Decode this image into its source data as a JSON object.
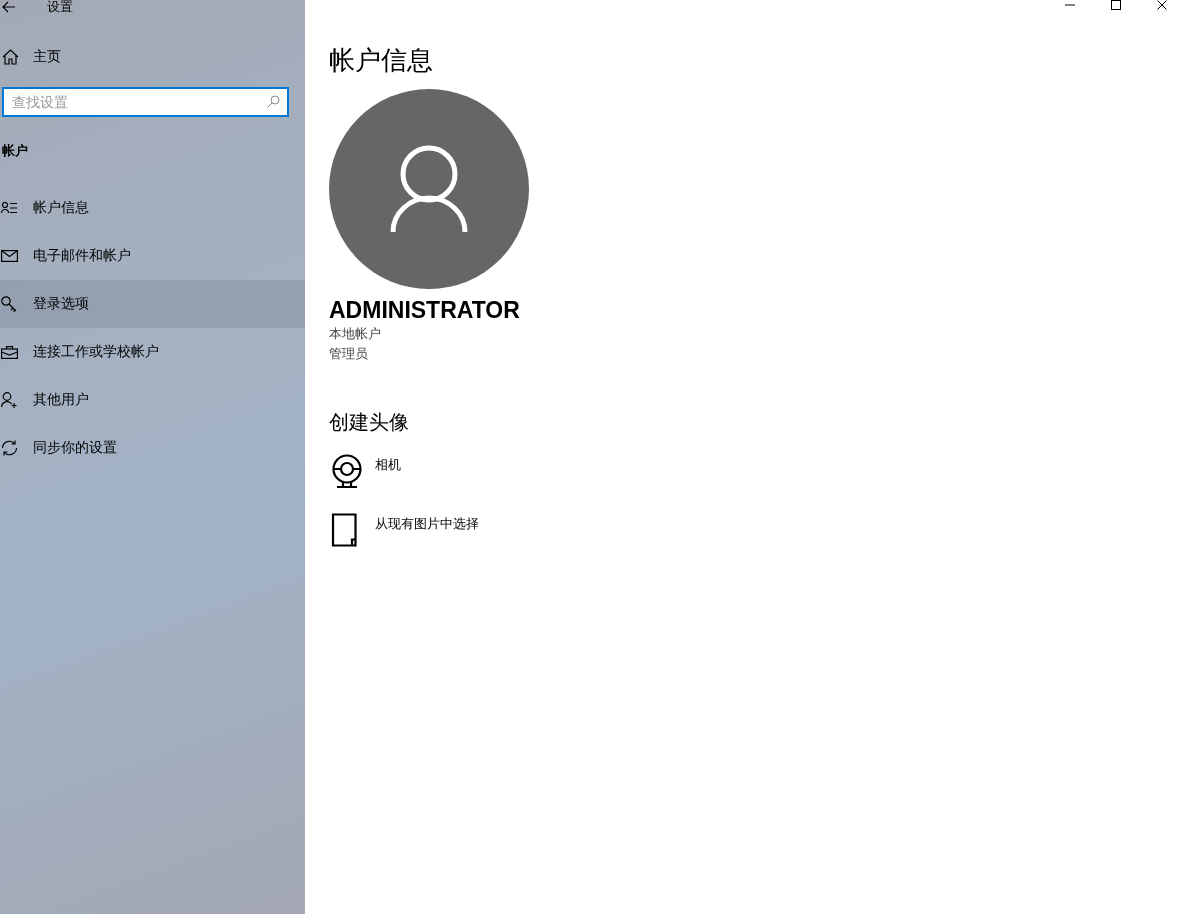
{
  "window": {
    "title": "设置",
    "controls": [
      {
        "kind": "minimize"
      },
      {
        "kind": "maximize"
      },
      {
        "kind": "close"
      }
    ]
  },
  "sidebar": {
    "home": "主页",
    "search": {
      "placeholder": "查找设置"
    },
    "section": "帐户",
    "items": [
      {
        "label": "帐户信息",
        "kind": "info",
        "selected": false
      },
      {
        "label": "电子邮件和帐户",
        "kind": "mail",
        "selected": false
      },
      {
        "label": "登录选项",
        "kind": "signin",
        "selected": true
      },
      {
        "label": "连接工作或学校帐户",
        "kind": "work",
        "selected": false
      },
      {
        "label": "其他用户",
        "kind": "users",
        "selected": false
      },
      {
        "label": "同步你的设置",
        "kind": "sync",
        "selected": false
      }
    ]
  },
  "main": {
    "title": "帐户信息",
    "user": {
      "name": "ADMINISTRATOR",
      "lines": [
        "本地帐户",
        "管理员"
      ]
    },
    "create_heading": "创建头像",
    "options": [
      {
        "label": "相机",
        "kind": "camera"
      },
      {
        "label": "从现有图片中选择",
        "kind": "browse"
      }
    ]
  }
}
